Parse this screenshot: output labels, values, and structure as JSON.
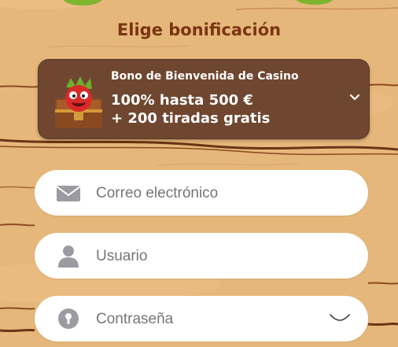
{
  "heading": "Elige bonificación",
  "bonus": {
    "subtitle": "Bono de Bienvenida de Casino",
    "line1": "100% hasta 500 €",
    "line2": "+ 200 tiradas gratis",
    "icon": "treasure-chest-mascot-icon",
    "chevron": "chevron-down-icon"
  },
  "fields": {
    "email": {
      "placeholder": "Correo electrónico",
      "icon": "envelope-icon"
    },
    "username": {
      "placeholder": "Usuario",
      "icon": "user-icon"
    },
    "password": {
      "placeholder": "Contraseña",
      "icon": "lock-icon",
      "toggle_icon": "eye-closed-icon"
    }
  },
  "colors": {
    "background": "#e6b77a",
    "heading": "#7a3512",
    "card": "#6f4630",
    "field": "#ffffff",
    "icon": "#9b9ba1"
  }
}
